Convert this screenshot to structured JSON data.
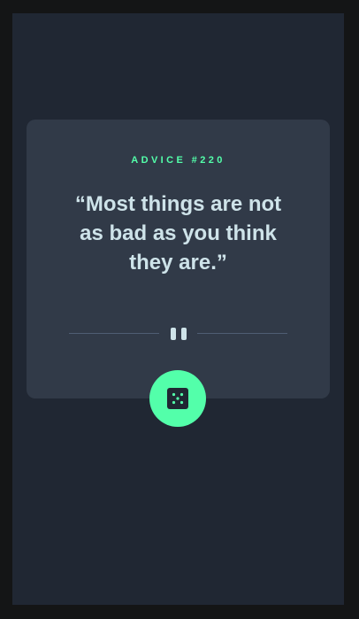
{
  "advice": {
    "label_prefix": "ADVICE #",
    "number": "220",
    "quote": "“Most things are not as bad as you think they are.”"
  },
  "divider": {
    "icon": "pause-icon"
  },
  "button": {
    "icon": "dice-icon"
  },
  "colors": {
    "background": "#202733",
    "frame": "#141516",
    "card": "#313a48",
    "accent": "#53ffaa",
    "text": "#cee3e9",
    "divider": "#4f5d74"
  }
}
